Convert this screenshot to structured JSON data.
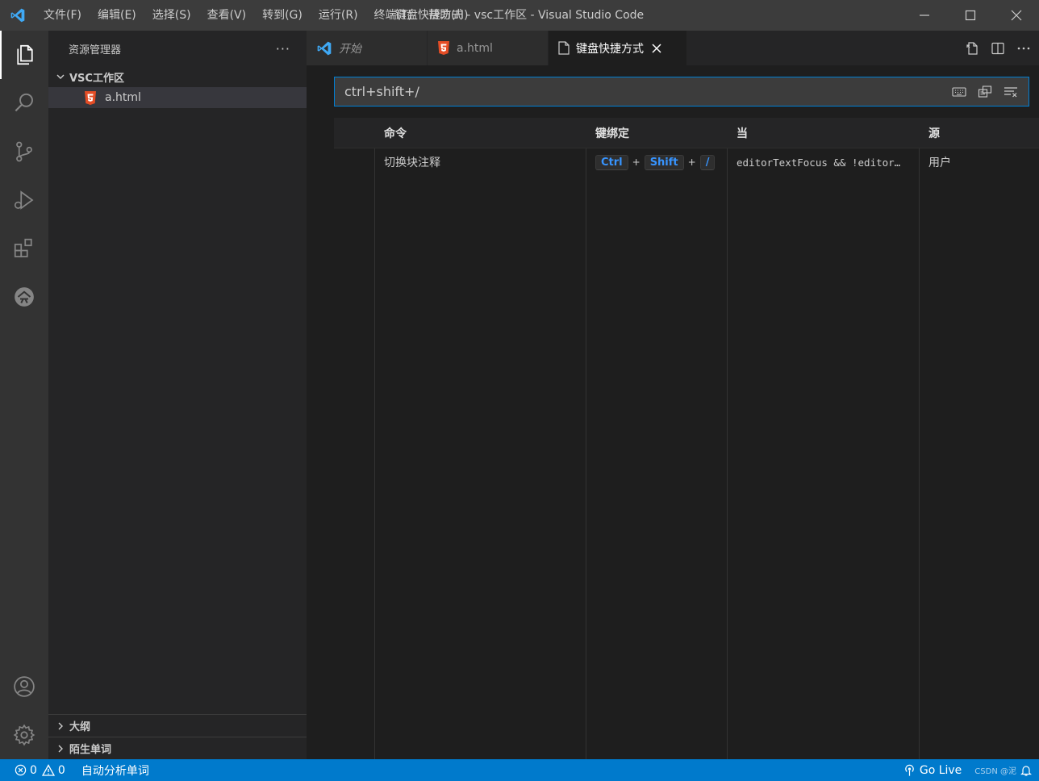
{
  "window": {
    "title": "键盘快捷方式 - vsc工作区 - Visual Studio Code"
  },
  "menu": [
    "文件(F)",
    "编辑(E)",
    "选择(S)",
    "查看(V)",
    "转到(G)",
    "运行(R)",
    "终端(T)",
    "帮助(H)"
  ],
  "sidebar": {
    "title": "资源管理器",
    "more": "···",
    "workspace": "VSC工作区",
    "files": [
      "a.html"
    ],
    "bottom_sections": [
      "大纲",
      "陌生单词"
    ]
  },
  "tabs": [
    {
      "label": "开始",
      "icon": "vscode-logo-icon",
      "active": false
    },
    {
      "label": "a.html",
      "icon": "html5-icon",
      "active": false
    },
    {
      "label": "键盘快捷方式",
      "icon": "file-icon",
      "active": true
    }
  ],
  "search": {
    "value": "ctrl+shift+/"
  },
  "table": {
    "headers": [
      "命令",
      "键绑定",
      "当",
      "源"
    ],
    "rows": [
      {
        "command": "切换块注释",
        "keys": [
          "Ctrl",
          "Shift",
          "/"
        ],
        "plus": "+",
        "when": "editorTextFocus && !editor…",
        "source": "用户"
      }
    ]
  },
  "statusbar": {
    "errors": "0",
    "warnings": "0",
    "extension": "自动分析单词",
    "go_live": "Go Live",
    "watermark": "CSDN @泥"
  },
  "colors": {
    "accent": "#007acc",
    "keybinding": "#3794ff"
  }
}
